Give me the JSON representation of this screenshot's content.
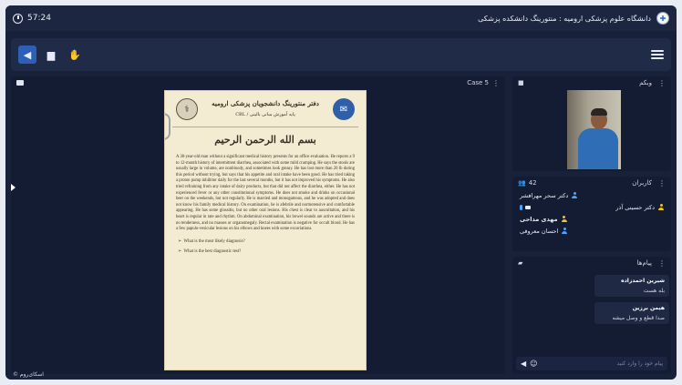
{
  "header": {
    "timer": "57:24",
    "title": "دانشگاه علوم پزشکی ارومیه : منتورینگ دانشکده پزشکی"
  },
  "presentation": {
    "label": "Case 5",
    "doc": {
      "org": "دفتر منتورینگ دانشجویان پزشکی ارومیه",
      "sub": "پایه آموزش مبانی بالینی / CBL",
      "basmala": "بسم الله الرحمن الرحیم",
      "case": "A 38-year-old man without a significant medical history presents for an office evaluation. He reports a 9 to 12-month history of intermittent diarrhea, associated with some mild cramping. He says the stools are usually large in volume, are nonbloody, and sometimes look greasy. He has lost more than 20 lb during this period without trying, but says that his appetite and oral intake have been good. He has tried taking a proton pump inhibitor daily for the last several months, but it has not improved his symptoms. He also tried refraining from any intake of dairy products, but that did not affect the diarrhea, either. He has not experienced fever or any other constitutional symptoms. He does not smoke and drinks on occasional beer on the weekends, but not regularly. He is married and monogamous, and he was adopted and does not know his family medical history. On examination, he is afebrile and normotensive and comfortable appearing. He has some glossitis, but no other oral lesions. His chest is clear to auscultation, and his heart is regular in rate and rhythm. On abdominal examination, his bowel sounds are active and there is no tenderness, and no masses or organomegaly. Rectal examination is negative for occult blood. He has a few papulo-vesicular lesions on his elbows and knees with some excoriations.",
      "questions": [
        "What is the most likely diagnosis?",
        "What is the best diagnostic test?"
      ]
    }
  },
  "webcam": {
    "label": "وبکم"
  },
  "users": {
    "label": "کاربران",
    "count": "42",
    "list": [
      {
        "name": "دکتر سحر مهرافشر",
        "color": "#4aa3ff"
      },
      {
        "name": "دکتر حسینی آذر",
        "color": "#f0c419"
      },
      {
        "name": "مهدی مداحی",
        "color": "#f0c419"
      },
      {
        "name": "احسان معروفی",
        "color": "#4aa3ff"
      }
    ]
  },
  "chat": {
    "label": "پیام‌ها",
    "messages": [
      {
        "who": "شیرین احمدزاده",
        "text": "بله هست"
      },
      {
        "who": "هیمن برزین",
        "text": "صدا قطع و وصل میشه"
      }
    ],
    "placeholder": "پیام خود را وارد کنید"
  },
  "brand": "اسکای‌روم ©"
}
